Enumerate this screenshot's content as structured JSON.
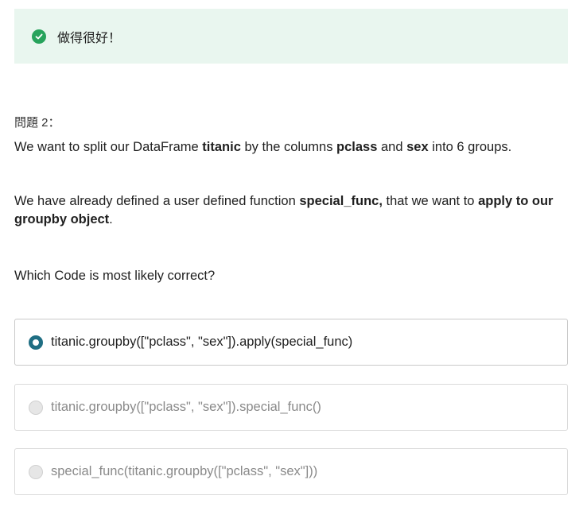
{
  "banner": {
    "message": "做得很好！",
    "icon": "check-circle-icon",
    "color": "#27a35c",
    "background": "#e9f6ef"
  },
  "question": {
    "number_label": "問題 2：",
    "p1": {
      "t1": "We want to split our DataFrame ",
      "b1": "titanic",
      "t2": " by the columns ",
      "b2": "pclass",
      "t3": " and ",
      "b3": "sex",
      "t4": " into 6 groups."
    },
    "p2": {
      "t1": "We have already defined a user defined function ",
      "b1": "special_func,",
      "t2": " that we want to ",
      "b2": "apply to our groupby object",
      "t3": "."
    },
    "p3": "Which Code is most likely correct?"
  },
  "options": [
    {
      "label": "titanic.groupby([\"pclass\", \"sex\"]).apply(special_func)",
      "selected": true
    },
    {
      "label": "titanic.groupby([\"pclass\", \"sex\"]).special_func()",
      "selected": false
    },
    {
      "label": "special_func(titanic.groupby([\"pclass\", \"sex\"]))",
      "selected": false
    }
  ],
  "colors": {
    "radio_selected": "#1f6e83",
    "disabled_text": "#8a8a8a"
  }
}
